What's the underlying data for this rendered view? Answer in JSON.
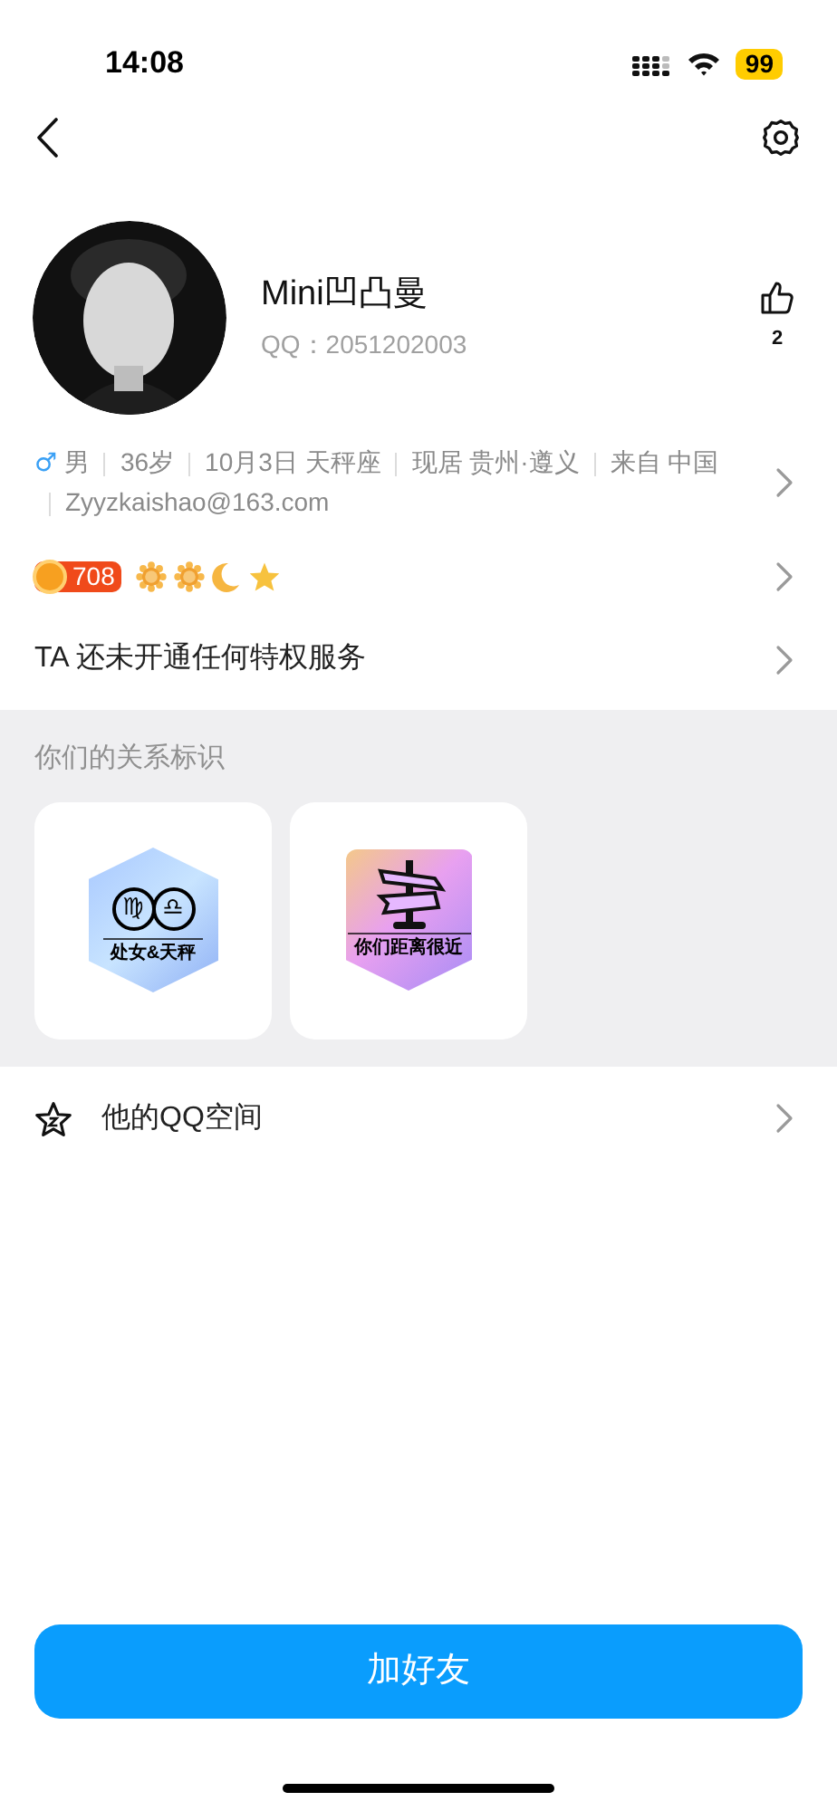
{
  "status_bar": {
    "time": "14:08",
    "battery": "99"
  },
  "profile": {
    "name": "Mini凹凸曼",
    "qq": "QQ：2051202003",
    "likes": "2"
  },
  "info": {
    "gender_symbol": "♂",
    "segments": [
      "男",
      "36岁",
      "10月3日 天秤座",
      "现居 贵州·遵义",
      "来自 中国",
      "Zyyzkaishao@163.com"
    ]
  },
  "level": {
    "value": "708",
    "icons": [
      {
        "kind": "sun"
      },
      {
        "kind": "sun"
      },
      {
        "kind": "moon"
      },
      {
        "kind": "star"
      }
    ]
  },
  "privilege": {
    "text": "TA 还未开通任何特权服务"
  },
  "relations": {
    "title": "你们的关系标识",
    "badges": [
      {
        "kind": "zodiac",
        "symbols": [
          "♍",
          "♎"
        ],
        "label": "处女&天秤"
      },
      {
        "kind": "signpost",
        "label": "你们距离很近"
      }
    ]
  },
  "qzone": {
    "label": "他的QQ空间"
  },
  "add_button": {
    "label": "加好友"
  }
}
